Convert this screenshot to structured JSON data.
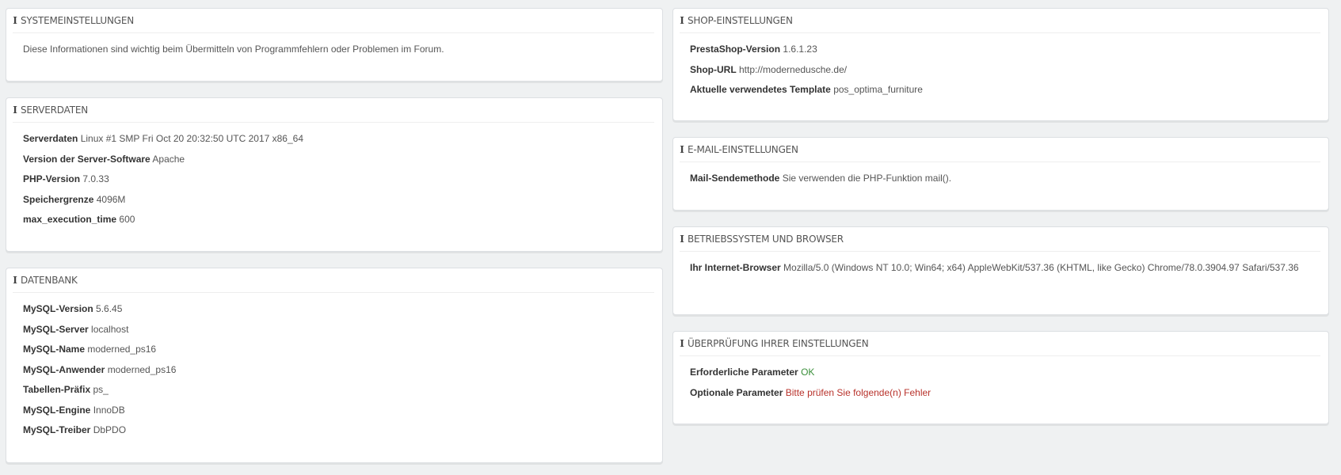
{
  "left": {
    "system": {
      "title": "SYSTEMEINSTELLUNGEN",
      "text": "Diese Informationen sind wichtig beim Übermitteln von Programmfehlern oder Problemen im Forum."
    },
    "server": {
      "title": "SERVERDATEN",
      "rows": [
        {
          "k": "Serverdaten",
          "v": "Linux #1 SMP Fri Oct 20 20:32:50 UTC 2017 x86_64"
        },
        {
          "k": "Version der Server-Software",
          "v": "Apache"
        },
        {
          "k": "PHP-Version",
          "v": "7.0.33"
        },
        {
          "k": "Speichergrenze",
          "v": "4096M"
        },
        {
          "k": "max_execution_time",
          "v": "600"
        }
      ]
    },
    "database": {
      "title": "DATENBANK",
      "rows": [
        {
          "k": "MySQL-Version",
          "v": "5.6.45"
        },
        {
          "k": "MySQL-Server",
          "v": "localhost"
        },
        {
          "k": "MySQL-Name",
          "v": "moderned_ps16"
        },
        {
          "k": "MySQL-Anwender",
          "v": "moderned_ps16"
        },
        {
          "k": "Tabellen-Präfix",
          "v": "ps_"
        },
        {
          "k": "MySQL-Engine",
          "v": "InnoDB"
        },
        {
          "k": "MySQL-Treiber",
          "v": "DbPDO"
        }
      ]
    }
  },
  "right": {
    "shop": {
      "title": "SHOP-EINSTELLUNGEN",
      "rows": [
        {
          "k": "PrestaShop-Version",
          "v": "1.6.1.23"
        },
        {
          "k": "Shop-URL",
          "v": "http://modernedusche.de/"
        },
        {
          "k": "Aktuelle verwendetes Template",
          "v": "pos_optima_furniture"
        }
      ]
    },
    "email": {
      "title": "E-MAIL-EINSTELLUNGEN",
      "rows": [
        {
          "k": "Mail-Sendemethode",
          "v": "Sie verwenden die PHP-Funktion mail()."
        }
      ]
    },
    "os": {
      "title": "BETRIEBSSYSTEM UND BROWSER",
      "rows": [
        {
          "k": "Ihr Internet-Browser",
          "v": "Mozilla/5.0 (Windows NT 10.0; Win64; x64) AppleWebKit/537.36 (KHTML, like Gecko) Chrome/78.0.3904.97 Safari/537.36"
        }
      ]
    },
    "check": {
      "title": "ÜBERPRÜFUNG IHRER EINSTELLUNGEN",
      "rows": [
        {
          "k": "Erforderliche Parameter",
          "v": "OK"
        },
        {
          "k": "Optionale Parameter",
          "v": "Bitte prüfen Sie folgende(n) Fehler"
        }
      ]
    }
  },
  "colors": {
    "ok": "#3a8f3a",
    "error": "#b8322b",
    "background": "#eff1f2"
  }
}
